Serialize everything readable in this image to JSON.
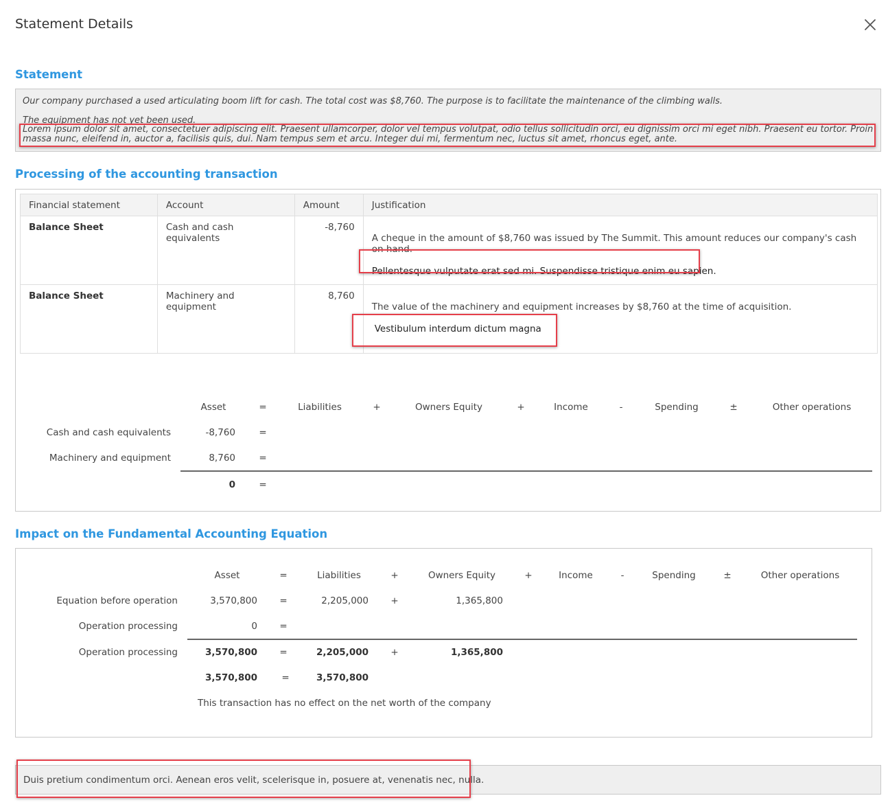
{
  "modal": {
    "title": "Statement Details",
    "close_icon": "close-icon"
  },
  "statement": {
    "heading": "Statement",
    "line1": "Our company purchased a used articulating boom lift for cash. The total cost was $8,760. The purpose is to facilitate the maintenance of the climbing walls.",
    "line2": "The equipment has not yet been used.",
    "lorem": "Lorem ipsum dolor sit amet, consectetuer adipiscing elit. Praesent ullamcorper, dolor vel tempus volutpat, odio tellus sollicitudin orci, eu dignissim orci mi eget nibh. Praesent eu tortor. Proin massa nunc, eleifend in, auctor a, facilisis quis, dui. Nam tempus sem et arcu. Integer dui mi, fermentum nec, luctus sit amet, rhoncus eget, ante."
  },
  "processing": {
    "heading": "Processing of the accounting transaction",
    "columns": [
      "Financial statement",
      "Account",
      "Amount",
      "Justification"
    ],
    "rows": [
      {
        "statement": "Balance Sheet",
        "account": "Cash and cash equivalents",
        "amount": "-8,760",
        "justification": "A cheque in the amount of $8,760 was issued by The Summit. This amount reduces our company's cash on hand.",
        "note": "Pellentesque vulputate erat sed mi. Suspendisse tristique enim eu sapien."
      },
      {
        "statement": "Balance Sheet",
        "account": "Machinery and equipment",
        "amount": "8,760",
        "justification": "The value of the machinery and equipment increases by $8,760 at the time of acquisition.",
        "note": "Vestibulum interdum dictum magna"
      }
    ],
    "equation": {
      "headers": {
        "asset": "Asset",
        "eq": "=",
        "liabilities": "Liabilities",
        "plus1": "+",
        "owners_equity": "Owners Equity",
        "plus2": "+",
        "income": "Income",
        "minus": "-",
        "spending": "Spending",
        "pm": "±",
        "other": "Other operations"
      },
      "rows": [
        {
          "label": "Cash and cash equivalents",
          "asset": "-8,760",
          "eq": "="
        },
        {
          "label": "Machinery and equipment",
          "asset": "8,760",
          "eq": "="
        }
      ],
      "total": {
        "asset": "0",
        "eq": "="
      }
    }
  },
  "impact": {
    "heading": "Impact on the Fundamental Accounting Equation",
    "headers": {
      "asset": "Asset",
      "eq": "=",
      "liabilities": "Liabilities",
      "plus1": "+",
      "owners_equity": "Owners Equity",
      "plus2": "+",
      "income": "Income",
      "minus": "-",
      "spending": "Spending",
      "pm": "±",
      "other": "Other operations"
    },
    "before": {
      "label": "Equation before operation",
      "asset": "3,570,800",
      "eq": "=",
      "liabilities": "2,205,000",
      "plus": "+",
      "owners_equity": "1,365,800"
    },
    "processing": {
      "label": "Operation processing",
      "asset": "0",
      "eq": "="
    },
    "after": {
      "label": "Operation processing",
      "asset": "3,570,800",
      "eq": "=",
      "liabilities": "2,205,000",
      "plus": "+",
      "owners_equity": "1,365,800"
    },
    "summary": {
      "asset": "3,570,800",
      "eq": "=",
      "total": "3,570,800"
    },
    "message": "This transaction has no effect on the net worth of the company"
  },
  "footer_note": "Duis pretium condimentum orci. Aenean eros velit, scelerisque in, posuere at, venenatis nec, nulla."
}
